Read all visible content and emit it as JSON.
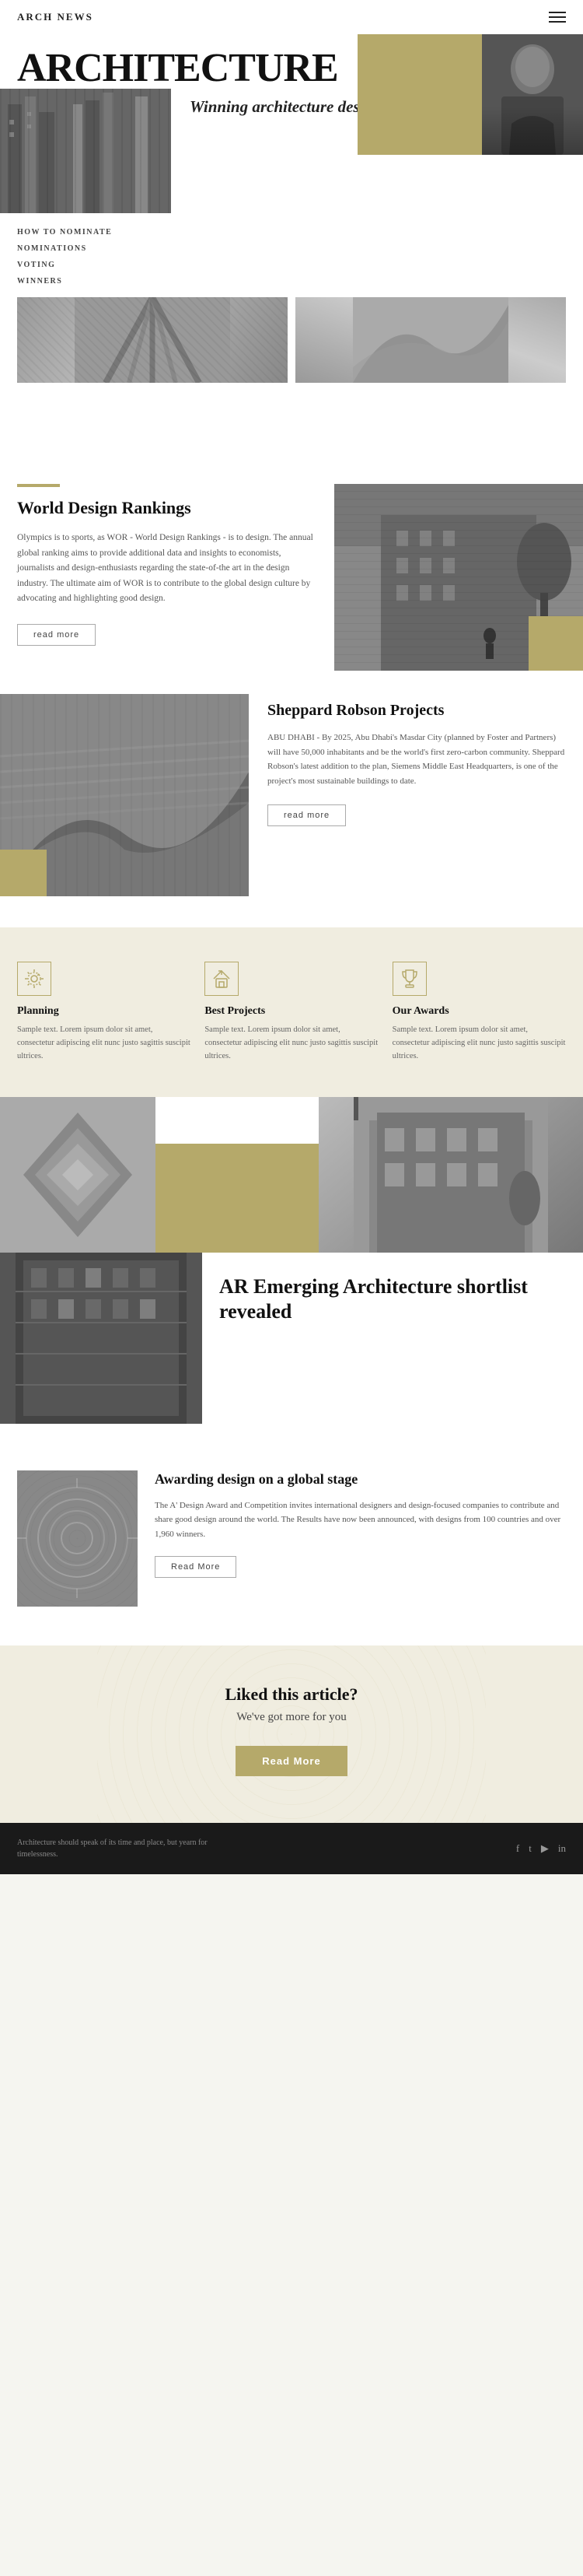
{
  "header": {
    "logo": "ARCH NEWS"
  },
  "hero": {
    "title": "ARCHITECTURE",
    "tagline": "Winning architecture design projects",
    "nav": {
      "item1": "HOW TO NOMINATE",
      "item2": "NOMINATIONS",
      "item3": "VOTING",
      "item4": "WINNERS"
    },
    "person_alt": "architect portrait"
  },
  "wdr": {
    "section_tag": "World Design Rankings",
    "body": "Olympics is to sports, as WOR - World Design Rankings - is to design. The annual global ranking aims to provide additional data and insights to economists, journalists and design-enthusiasts regarding the state-of-the art in the design industry. The ultimate aim of WOR is to contribute to the global design culture by advocating and highlighting good design.",
    "read_more": "read more"
  },
  "sheppard": {
    "title": "Sheppard Robson Projects",
    "body": "ABU DHABI - By 2025, Abu Dhabi's Masdar City (planned by Foster and Partners) will have 50,000 inhabitants and be the world's first zero-carbon community. Sheppard Robson's latest addition to the plan, Siemens Middle East Headquarters, is one of the project's most sustainable buildings to date.",
    "read_more": "read more"
  },
  "features": {
    "items": [
      {
        "icon": "⚙",
        "title": "Planning",
        "text": "Sample text. Lorem ipsum dolor sit amet, consectetur adipiscing elit nunc justo sagittis suscipit ultrices."
      },
      {
        "icon": "🏠",
        "title": "Best Projects",
        "text": "Sample text. Lorem ipsum dolor sit amet, consectetur adipiscing elit nunc justo sagittis suscipit ultrices."
      },
      {
        "icon": "🏆",
        "title": "Our Awards",
        "text": "Sample text. Lorem ipsum dolor sit amet, consectetur adipiscing elit nunc justo sagittis suscipit ultrices."
      }
    ]
  },
  "ar": {
    "title": "AR Emerging Architecture shortlist revealed"
  },
  "award": {
    "title": "Awarding design on a global stage",
    "body": "The A' Design Award and Competition invites international designers and design-focused companies to contribute and share good design around the world. The Results have now been announced, with designs from 100 countries and over 1,960 winners.",
    "read_more": "Read More"
  },
  "cta": {
    "title": "Liked this article?",
    "subtitle": "We've got more for you",
    "button": "Read More"
  },
  "footer": {
    "line1": "Architecture should speak of its time and place, but yearn for",
    "line2": "timelessness.",
    "socials": [
      "f",
      "t",
      "y",
      "in"
    ]
  }
}
